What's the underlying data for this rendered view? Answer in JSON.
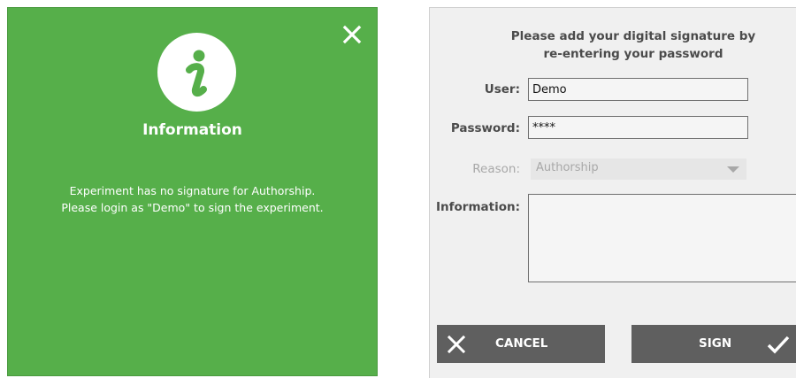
{
  "info_dialog": {
    "title": "Information",
    "message_line1": "Experiment has no signature for Authorship.",
    "message_line2": "Please login as \"Demo\" to sign the experiment.",
    "icon": "info-icon",
    "close_icon": "close-icon",
    "background_color": "#56af4a"
  },
  "signature_dialog": {
    "heading_line1": "Please add your digital signature by",
    "heading_line2": "re-entering your password",
    "user_label": "User:",
    "user_value": "Demo",
    "password_label": "Password:",
    "password_value": "****",
    "reason_label": "Reason:",
    "reason_value": "Authorship",
    "information_label": "Information:",
    "information_value": "",
    "cancel_label": "CANCEL",
    "sign_label": "SIGN",
    "cancel_icon": "close-icon",
    "sign_icon": "checkmark-icon"
  }
}
